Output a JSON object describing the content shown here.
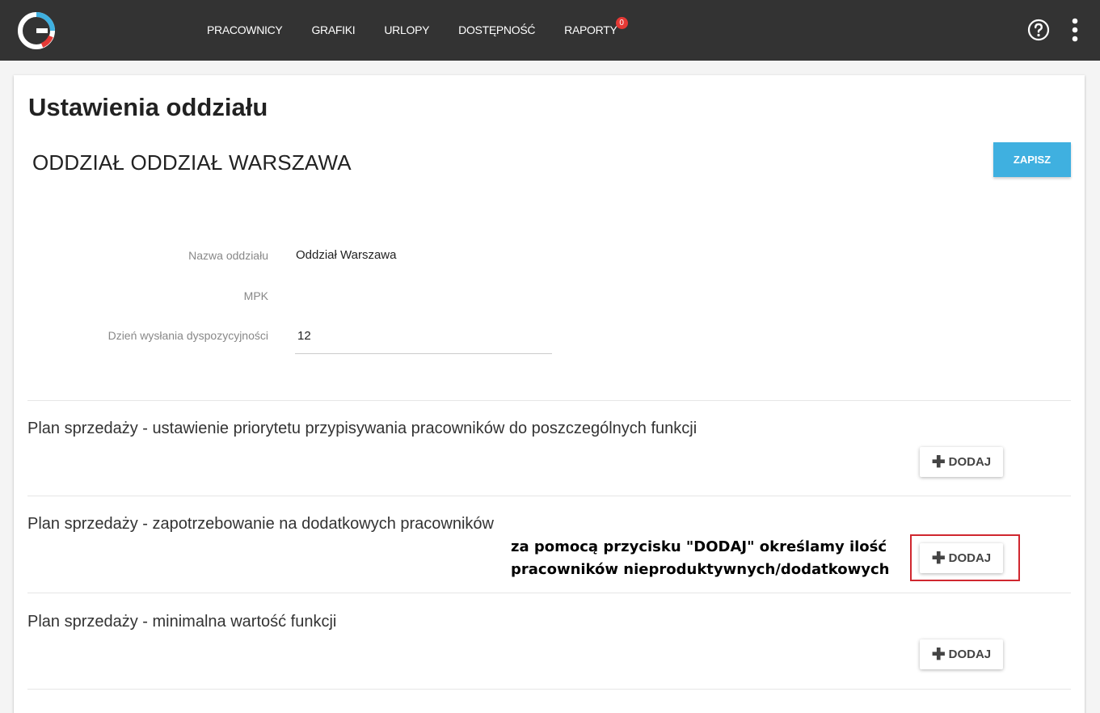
{
  "nav": {
    "items": [
      "PRACOWNICY",
      "GRAFIKI",
      "URLOPY",
      "DOSTĘPNOŚĆ",
      "RAPORTY"
    ],
    "reports_badge": "0"
  },
  "page": {
    "title": "Ustawienia oddziału",
    "branch_title": "ODDZIAŁ ODDZIAŁ WARSZAWA",
    "save_label": "ZAPISZ"
  },
  "form": {
    "name_label": "Nazwa oddziału",
    "name_value": "Oddział Warszawa",
    "mpk_label": "MPK",
    "day_label": "Dzień wysłania dyspozycyjności",
    "day_value": "12"
  },
  "sections": [
    {
      "title": "Plan sprzedaży - ustawienie priorytetu przypisywania pracowników do poszczególnych funkcji",
      "button": "DODAJ"
    },
    {
      "title": "Plan sprzedaży - zapotrzebowanie na dodatkowych pracowników",
      "button": "DODAJ"
    },
    {
      "title": "Plan sprzedaży - minimalna wartość funkcji",
      "button": "DODAJ"
    }
  ],
  "annotation": {
    "line1": "za pomocą przycisku \"DODAJ\" określamy ilość",
    "line2": "pracowników nieproduktywnych/dodatkowych"
  },
  "colors": {
    "topbar": "#333333",
    "accent": "#3fb0e0",
    "highlight": "#d0272f",
    "badge": "#e53935"
  },
  "icons": [
    "app-logo",
    "help-icon",
    "more-vertical-icon",
    "plus-icon"
  ]
}
